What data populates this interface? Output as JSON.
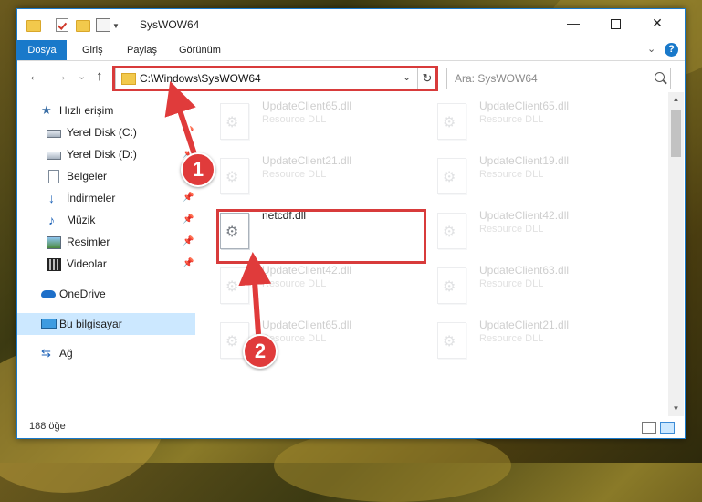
{
  "titlebar": {
    "title": "SysWOW64",
    "minimize": "—",
    "maximize": "",
    "close": "✕"
  },
  "ribbon": {
    "tabs": [
      "Dosya",
      "Giriş",
      "Paylaş",
      "Görünüm"
    ],
    "expand": "⌄",
    "help": "?"
  },
  "nav": {
    "back": "←",
    "forward": "→",
    "recent": "⌄",
    "up": "↑",
    "path": "C:\\Windows\\SysWOW64",
    "dropdown": "⌄",
    "refresh": "↻",
    "search_placeholder": "Ara: SysWOW64"
  },
  "sidebar": {
    "items": [
      {
        "label": "Hızlı erişim"
      },
      {
        "label": "Yerel Disk (C:)"
      },
      {
        "label": "Yerel Disk (D:)"
      },
      {
        "label": "Belgeler"
      },
      {
        "label": "İndirmeler"
      },
      {
        "label": "Müzik"
      },
      {
        "label": "Resimler"
      },
      {
        "label": "Videolar"
      },
      {
        "label": "OneDrive"
      },
      {
        "label": "Bu bilgisayar"
      },
      {
        "label": "Ağ"
      }
    ],
    "pin": "📌"
  },
  "files": [
    {
      "name": "UpdateClient65.dll",
      "type": "Resource DLL"
    },
    {
      "name": "UpdateClient65.dll",
      "type": "Resource DLL"
    },
    {
      "name": "UpdateClient21.dll",
      "type": "Resource DLL"
    },
    {
      "name": "UpdateClient19.dll",
      "type": "Resource DLL"
    },
    {
      "name": "netcdf.dll",
      "type": ""
    },
    {
      "name": "UpdateClient42.dll",
      "type": "Resource DLL"
    },
    {
      "name": "UpdateClient42.dll",
      "type": "Resource DLL"
    },
    {
      "name": "UpdateClient63.dll",
      "type": "Resource DLL"
    },
    {
      "name": "UpdateClient65.dll",
      "type": "Resource DLL"
    },
    {
      "name": "UpdateClient21.dll",
      "type": "Resource DLL"
    }
  ],
  "status": {
    "count": "188 öğe"
  },
  "annotations": {
    "step1": "1",
    "step2": "2"
  },
  "colors": {
    "accent": "#1979ca",
    "highlight": "#d83b3b",
    "badge": "#e03b3b",
    "selected": "#cce8ff"
  }
}
